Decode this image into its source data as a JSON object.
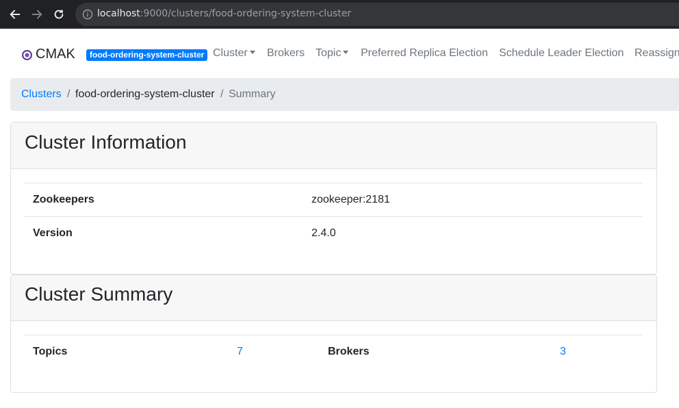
{
  "browser": {
    "url_host": "localhost",
    "url_rest": ":9000/clusters/food-ordering-system-cluster"
  },
  "navbar": {
    "brand": "CMAK",
    "cluster_badge": "food-ordering-system-cluster",
    "items": [
      {
        "label": "Cluster",
        "dropdown": true
      },
      {
        "label": "Brokers",
        "dropdown": false
      },
      {
        "label": "Topic",
        "dropdown": true
      },
      {
        "label": "Preferred Replica Election",
        "dropdown": false
      },
      {
        "label": "Schedule Leader Election",
        "dropdown": false
      },
      {
        "label": "Reassign",
        "dropdown": false
      }
    ]
  },
  "breadcrumb": {
    "items": [
      "Clusters",
      "food-ordering-system-cluster",
      "Summary"
    ],
    "separator": "/"
  },
  "cluster_information": {
    "title": "Cluster Information",
    "rows": [
      {
        "label": "Zookeepers",
        "value": "zookeeper:2181"
      },
      {
        "label": "Version",
        "value": "2.4.0"
      }
    ]
  },
  "cluster_summary": {
    "title": "Cluster Summary",
    "topics_label": "Topics",
    "topics_value": "7",
    "brokers_label": "Brokers",
    "brokers_value": "3"
  },
  "colors": {
    "link": "#007bff",
    "badge": "#007bff",
    "muted": "#6c757d",
    "breadcrumb_bg": "#e9ecef",
    "card_header_bg": "#f7f7f7"
  },
  "icons": [
    "back-arrow-icon",
    "forward-arrow-icon",
    "reload-icon",
    "info-icon",
    "cmak-logo-icon"
  ]
}
